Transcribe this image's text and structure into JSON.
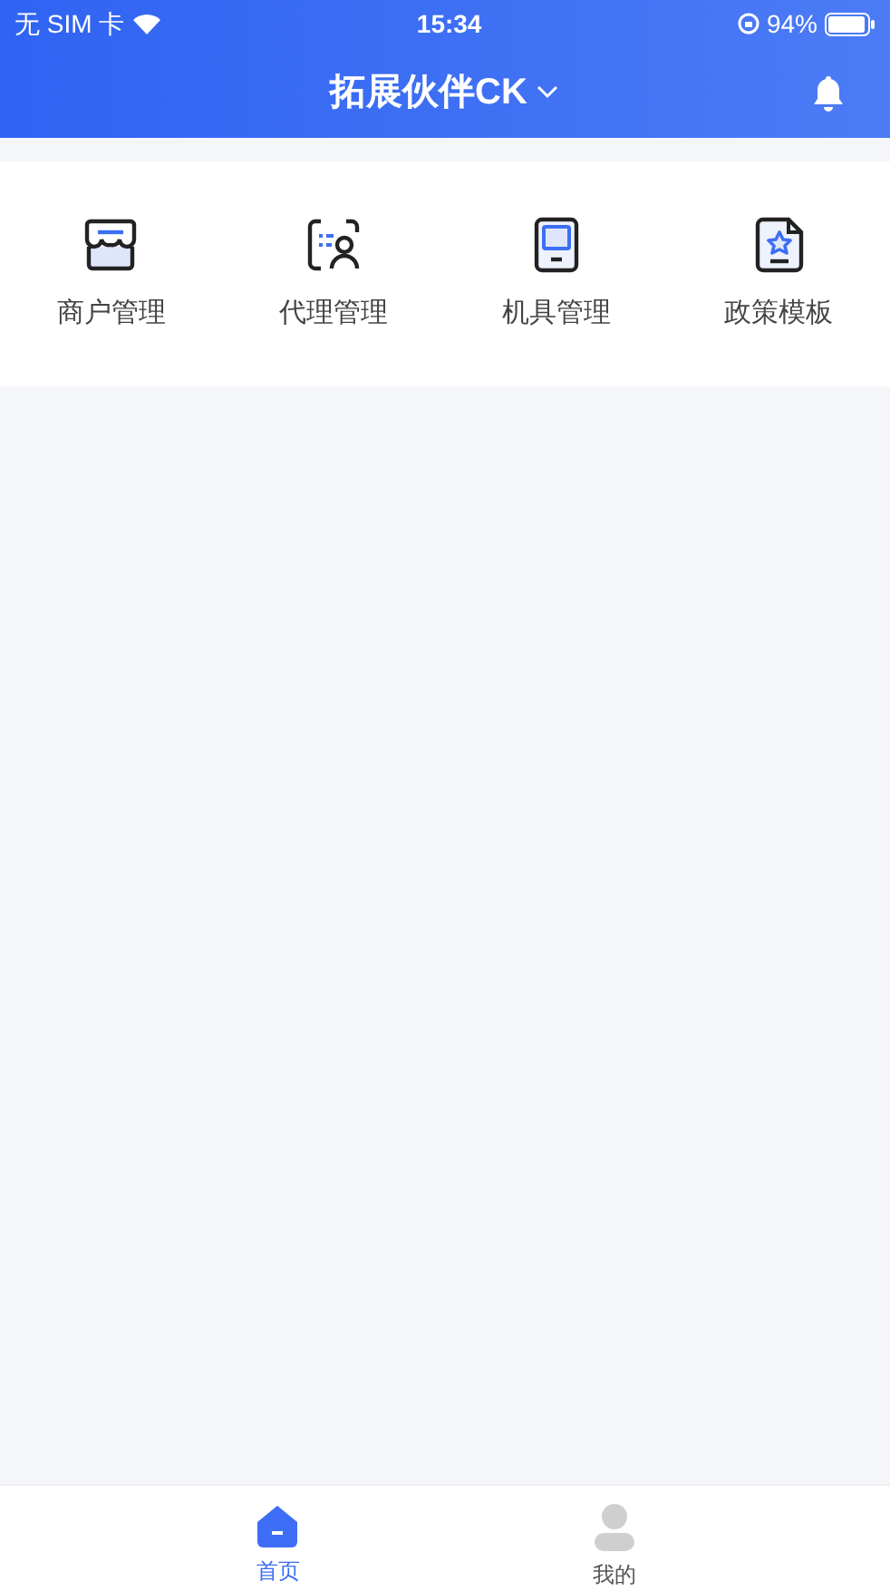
{
  "status_bar": {
    "carrier": "无 SIM 卡",
    "time": "15:34",
    "battery": "94%"
  },
  "header": {
    "title": "拓展伙伴CK"
  },
  "menu": [
    {
      "kind": "store",
      "label": "商户管理"
    },
    {
      "kind": "agent",
      "label": "代理管理"
    },
    {
      "kind": "device",
      "label": "机具管理"
    },
    {
      "kind": "document",
      "label": "政策模板"
    }
  ],
  "tab_bar": [
    {
      "kind": "home",
      "label": "首页",
      "selected": true
    },
    {
      "kind": "profile",
      "label": "我的",
      "selected": false
    }
  ]
}
